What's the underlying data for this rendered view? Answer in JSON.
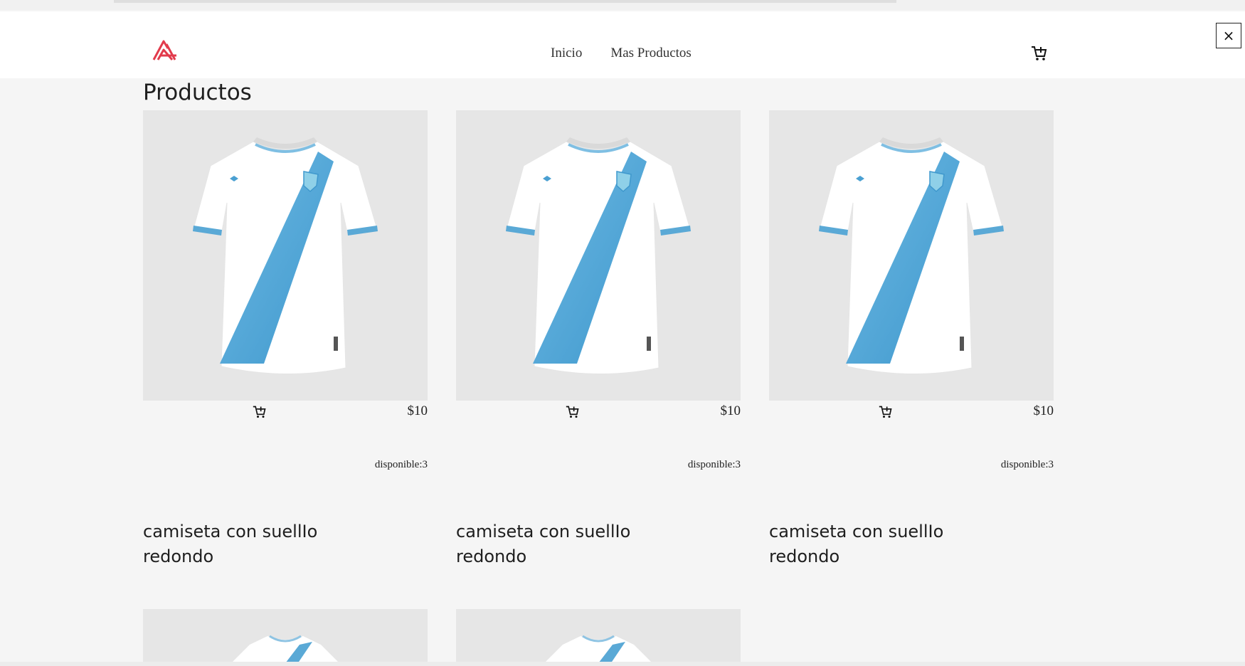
{
  "nav": {
    "links": [
      "Inicio",
      "Mas Productos"
    ],
    "close_label": "×",
    "brand_color": "#e23b4c"
  },
  "page": {
    "title": "Productos"
  },
  "products": [
    {
      "name": "camiseta con suellIo redondo",
      "price": "$10",
      "availability": "disponible:3"
    },
    {
      "name": "camiseta con suellIo redondo",
      "price": "$10",
      "availability": "disponible:3"
    },
    {
      "name": "camiseta con suellIo redondo",
      "price": "$10",
      "availability": "disponible:3"
    }
  ],
  "icons": {
    "logo": "brand-logo-icon",
    "cart": "cart-add-icon",
    "close": "close-icon",
    "product_image": "jersey-image"
  }
}
